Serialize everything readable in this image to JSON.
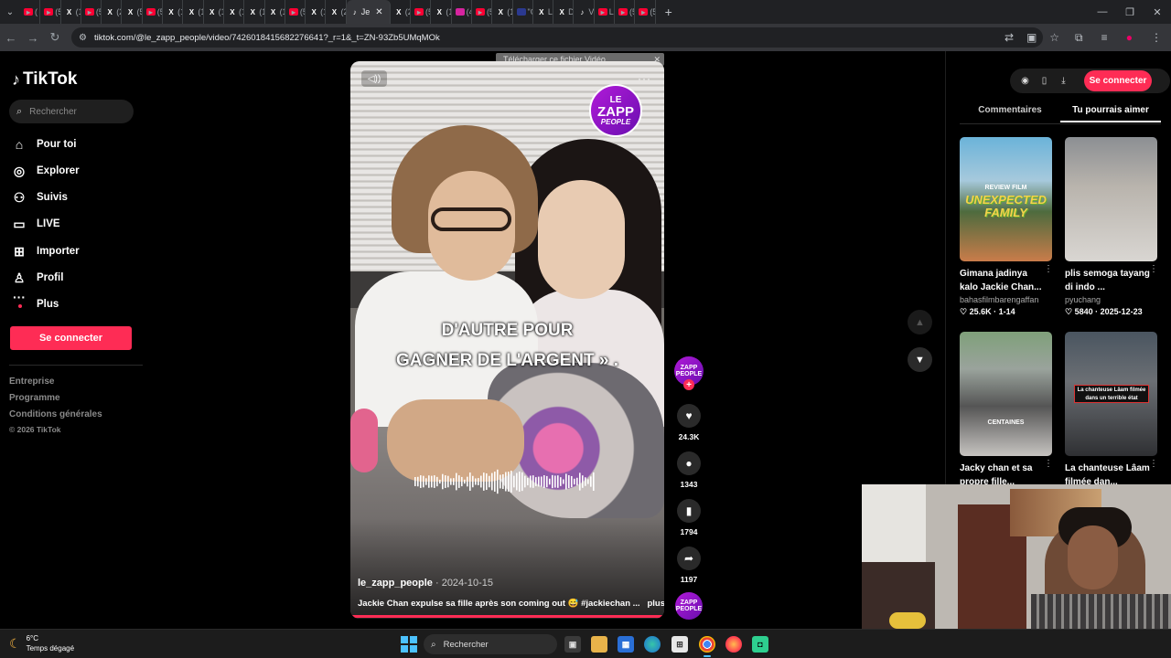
{
  "browser": {
    "tabs": [
      {
        "icon": "youtube-icon",
        "label": "(",
        "kind": "yt"
      },
      {
        "icon": "youtube-icon",
        "label": "(5",
        "kind": "yt"
      },
      {
        "icon": "x-icon",
        "label": "(1",
        "kind": "x"
      },
      {
        "icon": "youtube-icon",
        "label": "(5",
        "kind": "yt"
      },
      {
        "icon": "x-icon",
        "label": "(2",
        "kind": "x"
      },
      {
        "icon": "x-icon",
        "label": "(5",
        "kind": "x"
      },
      {
        "icon": "youtube-icon",
        "label": "(5",
        "kind": "yt"
      },
      {
        "icon": "x-icon",
        "label": "(1",
        "kind": "x"
      },
      {
        "icon": "x-icon",
        "label": "(1",
        "kind": "x"
      },
      {
        "icon": "x-icon",
        "label": "(1",
        "kind": "x"
      },
      {
        "icon": "x-icon",
        "label": "(1",
        "kind": "x"
      },
      {
        "icon": "x-icon",
        "label": "(1",
        "kind": "x"
      },
      {
        "icon": "x-icon",
        "label": "(1",
        "kind": "x"
      },
      {
        "icon": "youtube-icon",
        "label": "(5",
        "kind": "yt"
      },
      {
        "icon": "x-icon",
        "label": "(1",
        "kind": "x"
      },
      {
        "icon": "x-icon",
        "label": "(2",
        "kind": "x"
      }
    ],
    "active_tab": {
      "icon": "tiktok-icon",
      "label": "Je",
      "close": "✕"
    },
    "tabs_after": [
      {
        "icon": "x-icon",
        "label": "(2",
        "kind": "x"
      },
      {
        "icon": "youtube-icon",
        "label": "(5",
        "kind": "yt"
      },
      {
        "icon": "x-icon",
        "label": "(1",
        "kind": "x"
      },
      {
        "icon": "instagram-icon",
        "label": "(4",
        "kind": "ig"
      },
      {
        "icon": "youtube-icon",
        "label": "(5",
        "kind": "yt"
      },
      {
        "icon": "x-icon",
        "label": "(1",
        "kind": "x"
      },
      {
        "icon": "flag-icon",
        "label": "\"C",
        "kind": "fl"
      },
      {
        "icon": "x-icon",
        "label": "Li",
        "kind": "x"
      },
      {
        "icon": "x-icon",
        "label": "D",
        "kind": "x"
      },
      {
        "icon": "tiktok-icon",
        "label": "V",
        "kind": "tt"
      },
      {
        "icon": "youtube-icon",
        "label": "Li",
        "kind": "yt"
      },
      {
        "icon": "youtube-icon",
        "label": "(5",
        "kind": "yt"
      },
      {
        "icon": "youtube-icon",
        "label": "(5",
        "kind": "yt"
      }
    ],
    "new_tab": "+",
    "url": "tiktok.com/@le_zapp_people/video/7426018415682276641?_r=1&_t=ZN-93Zb5UMqMOk",
    "overlay_download": "Télécharger ce fichier Vidéo",
    "overlay_close": "✕"
  },
  "sidebar": {
    "logo": "TikTok",
    "search_placeholder": "Rechercher",
    "nav": [
      {
        "label": "Pour toi",
        "icon": "home-icon"
      },
      {
        "label": "Explorer",
        "icon": "compass-icon"
      },
      {
        "label": "Suivis",
        "icon": "following-icon"
      },
      {
        "label": "LIVE",
        "icon": "live-icon"
      },
      {
        "label": "Importer",
        "icon": "upload-icon"
      },
      {
        "label": "Profil",
        "icon": "profile-icon"
      },
      {
        "label": "Plus",
        "icon": "more-icon"
      }
    ],
    "login": "Se connecter",
    "footer": [
      "Entreprise",
      "Programme",
      "Conditions générales"
    ],
    "copyright": "© 2026 TikTok"
  },
  "video": {
    "badge": {
      "l1": "LE",
      "l2": "ZAPP",
      "l3": "PEOPLE"
    },
    "caption_line1": "D'AUTRE POUR",
    "caption_line2": "GAGNER DE L'ARGENT » .",
    "author": "le_zapp_people",
    "date": " · 2024-10-15",
    "description": "Jackie Chan expulse sa fille après son coming out 😅 #jackiechan ...",
    "more": "plus"
  },
  "actions": {
    "avatar": {
      "l1": "ZAPP",
      "l2": "PEOPLE"
    },
    "likes": "24.3K",
    "comments": "1343",
    "saves": "1794",
    "shares": "1197"
  },
  "right": {
    "login": "Se connecter",
    "tabs": [
      "Commentaires",
      "Tu pourrais aimer"
    ],
    "cards": [
      {
        "title": "Gimana jadinya kalo Jackie Chan...",
        "user": "bahasfilmbarengaffan",
        "likes": "25.6K",
        "date": "1-14",
        "t1": "REVIEW FILM",
        "t2": "UNEXPECTED FAMILY"
      },
      {
        "title": "plis semoga tayang di indo ...",
        "user": "pyuchang",
        "likes": "5840",
        "date": "2025-12-23"
      },
      {
        "title": "Jacky chan et sa propre fille...",
        "t3": "CENTAINES"
      },
      {
        "title": "La chanteuse Lâam filmée dan...",
        "tlabel": "La chanteuse Lâam filmée dans un terrible état"
      }
    ]
  },
  "taskbar": {
    "temp": "6°C",
    "weather": "Temps dégagé",
    "search": "Rechercher"
  }
}
